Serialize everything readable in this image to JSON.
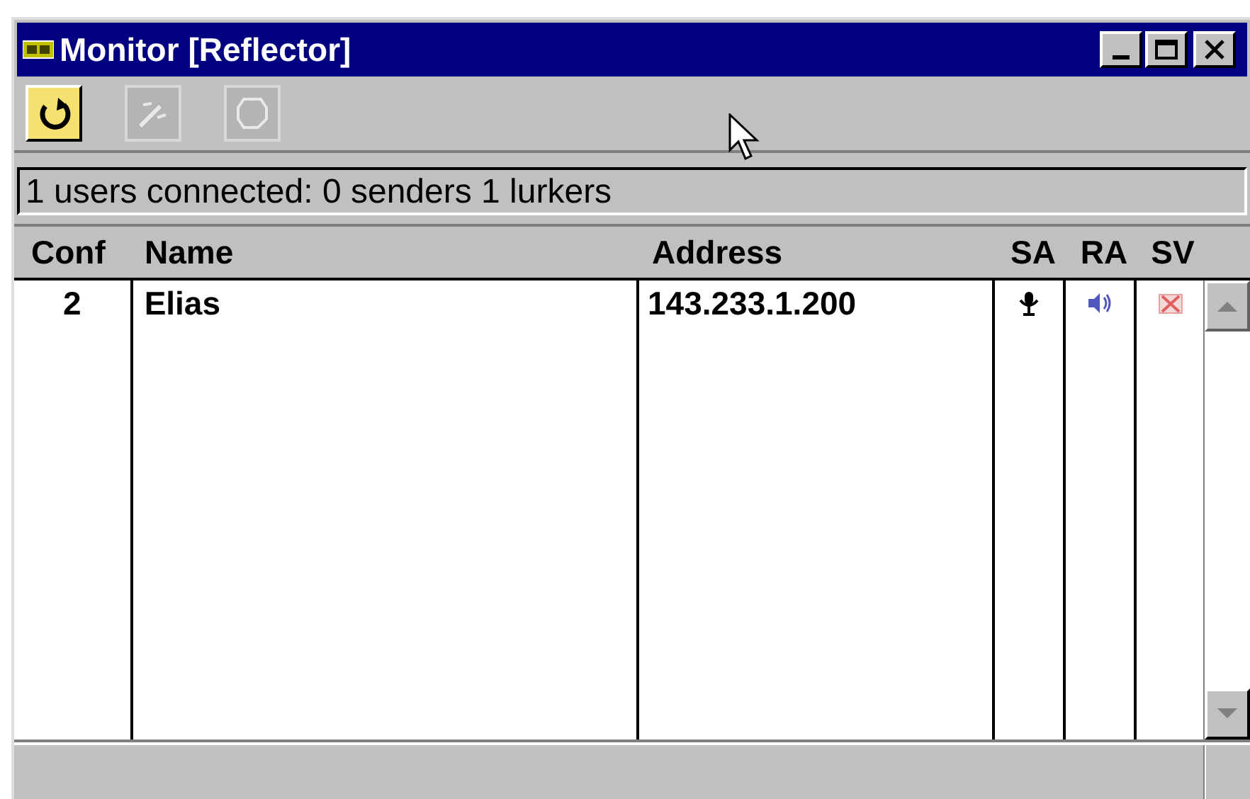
{
  "window": {
    "title": "Monitor [Reflector]"
  },
  "toolbar": [
    {
      "kind": "refresh",
      "disabled": false
    },
    {
      "kind": "wand",
      "disabled": true
    },
    {
      "kind": "loop",
      "disabled": true
    }
  ],
  "status": "1 users connected: 0 senders 1 lurkers",
  "table": {
    "columns": [
      "Conf",
      "Name",
      "Address",
      "SA",
      "RA",
      "SV"
    ],
    "rows": [
      {
        "conf": "2",
        "name": "Elias",
        "address": "143.233.1.200"
      }
    ]
  }
}
